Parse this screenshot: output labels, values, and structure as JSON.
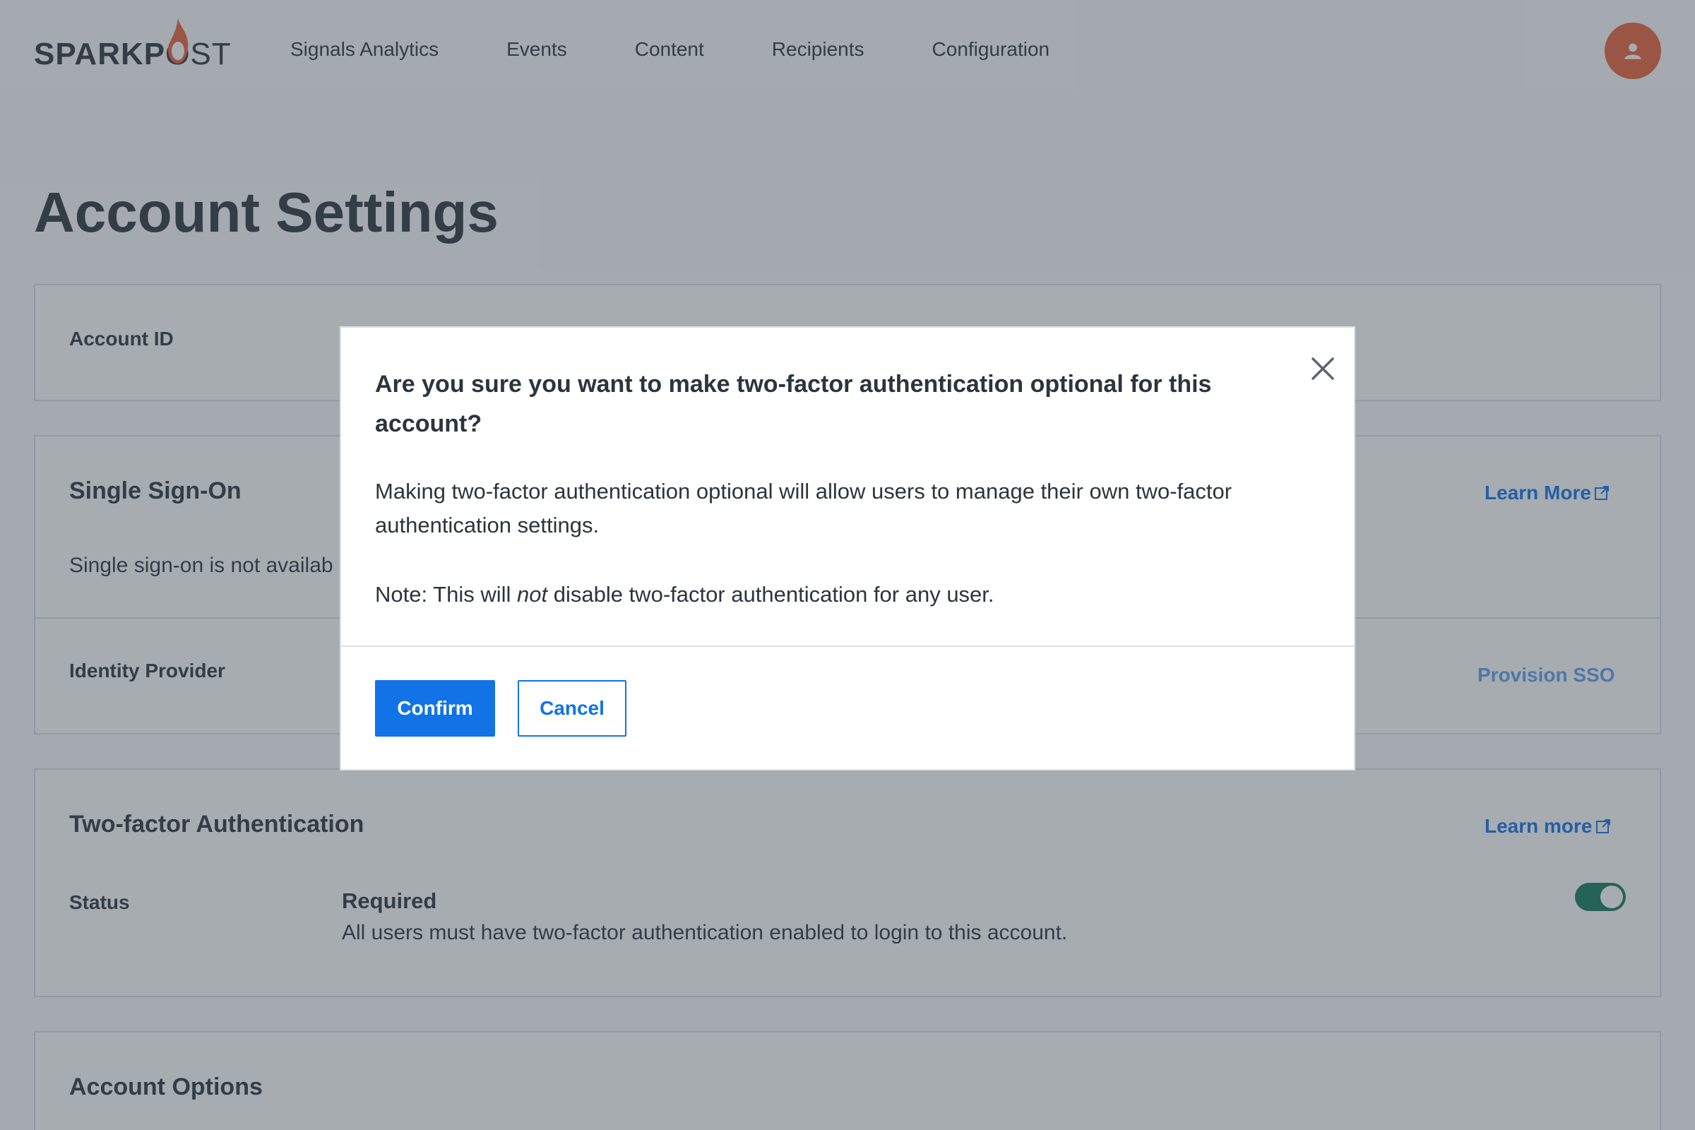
{
  "brand": {
    "logo_bold": "SPARKP",
    "logo_o": "O",
    "logo_light": "ST",
    "flame_color": "#e8613a"
  },
  "nav": {
    "items": [
      "Signals Analytics",
      "Events",
      "Content",
      "Recipients",
      "Configuration"
    ]
  },
  "page": {
    "title": "Account Settings"
  },
  "account_id": {
    "label": "Account ID"
  },
  "sso": {
    "heading": "Single Sign-On",
    "learn_more": "Learn More",
    "description": "Single sign-on is not availab",
    "identity_label": "Identity Provider",
    "provision_link": "Provision SSO"
  },
  "tfa": {
    "heading": "Two-factor Authentication",
    "learn_more": "Learn more",
    "status_label": "Status",
    "status_value": "Required",
    "status_desc": "All users must have two-factor authentication enabled to login to this account.",
    "toggle_on": true
  },
  "account_options": {
    "heading": "Account Options"
  },
  "modal": {
    "title": "Are you sure you want to make two-factor authentication optional for this account?",
    "body": "Making two-factor authentication optional will allow users to manage their own two-factor authentication settings.",
    "note_prefix": "Note: This will ",
    "note_em": "not",
    "note_suffix": " disable two-factor authentication for any user.",
    "confirm_label": "Confirm",
    "cancel_label": "Cancel"
  },
  "colors": {
    "primary": "#1273e6",
    "avatar": "#e8613a",
    "toggle": "#147a5b"
  }
}
